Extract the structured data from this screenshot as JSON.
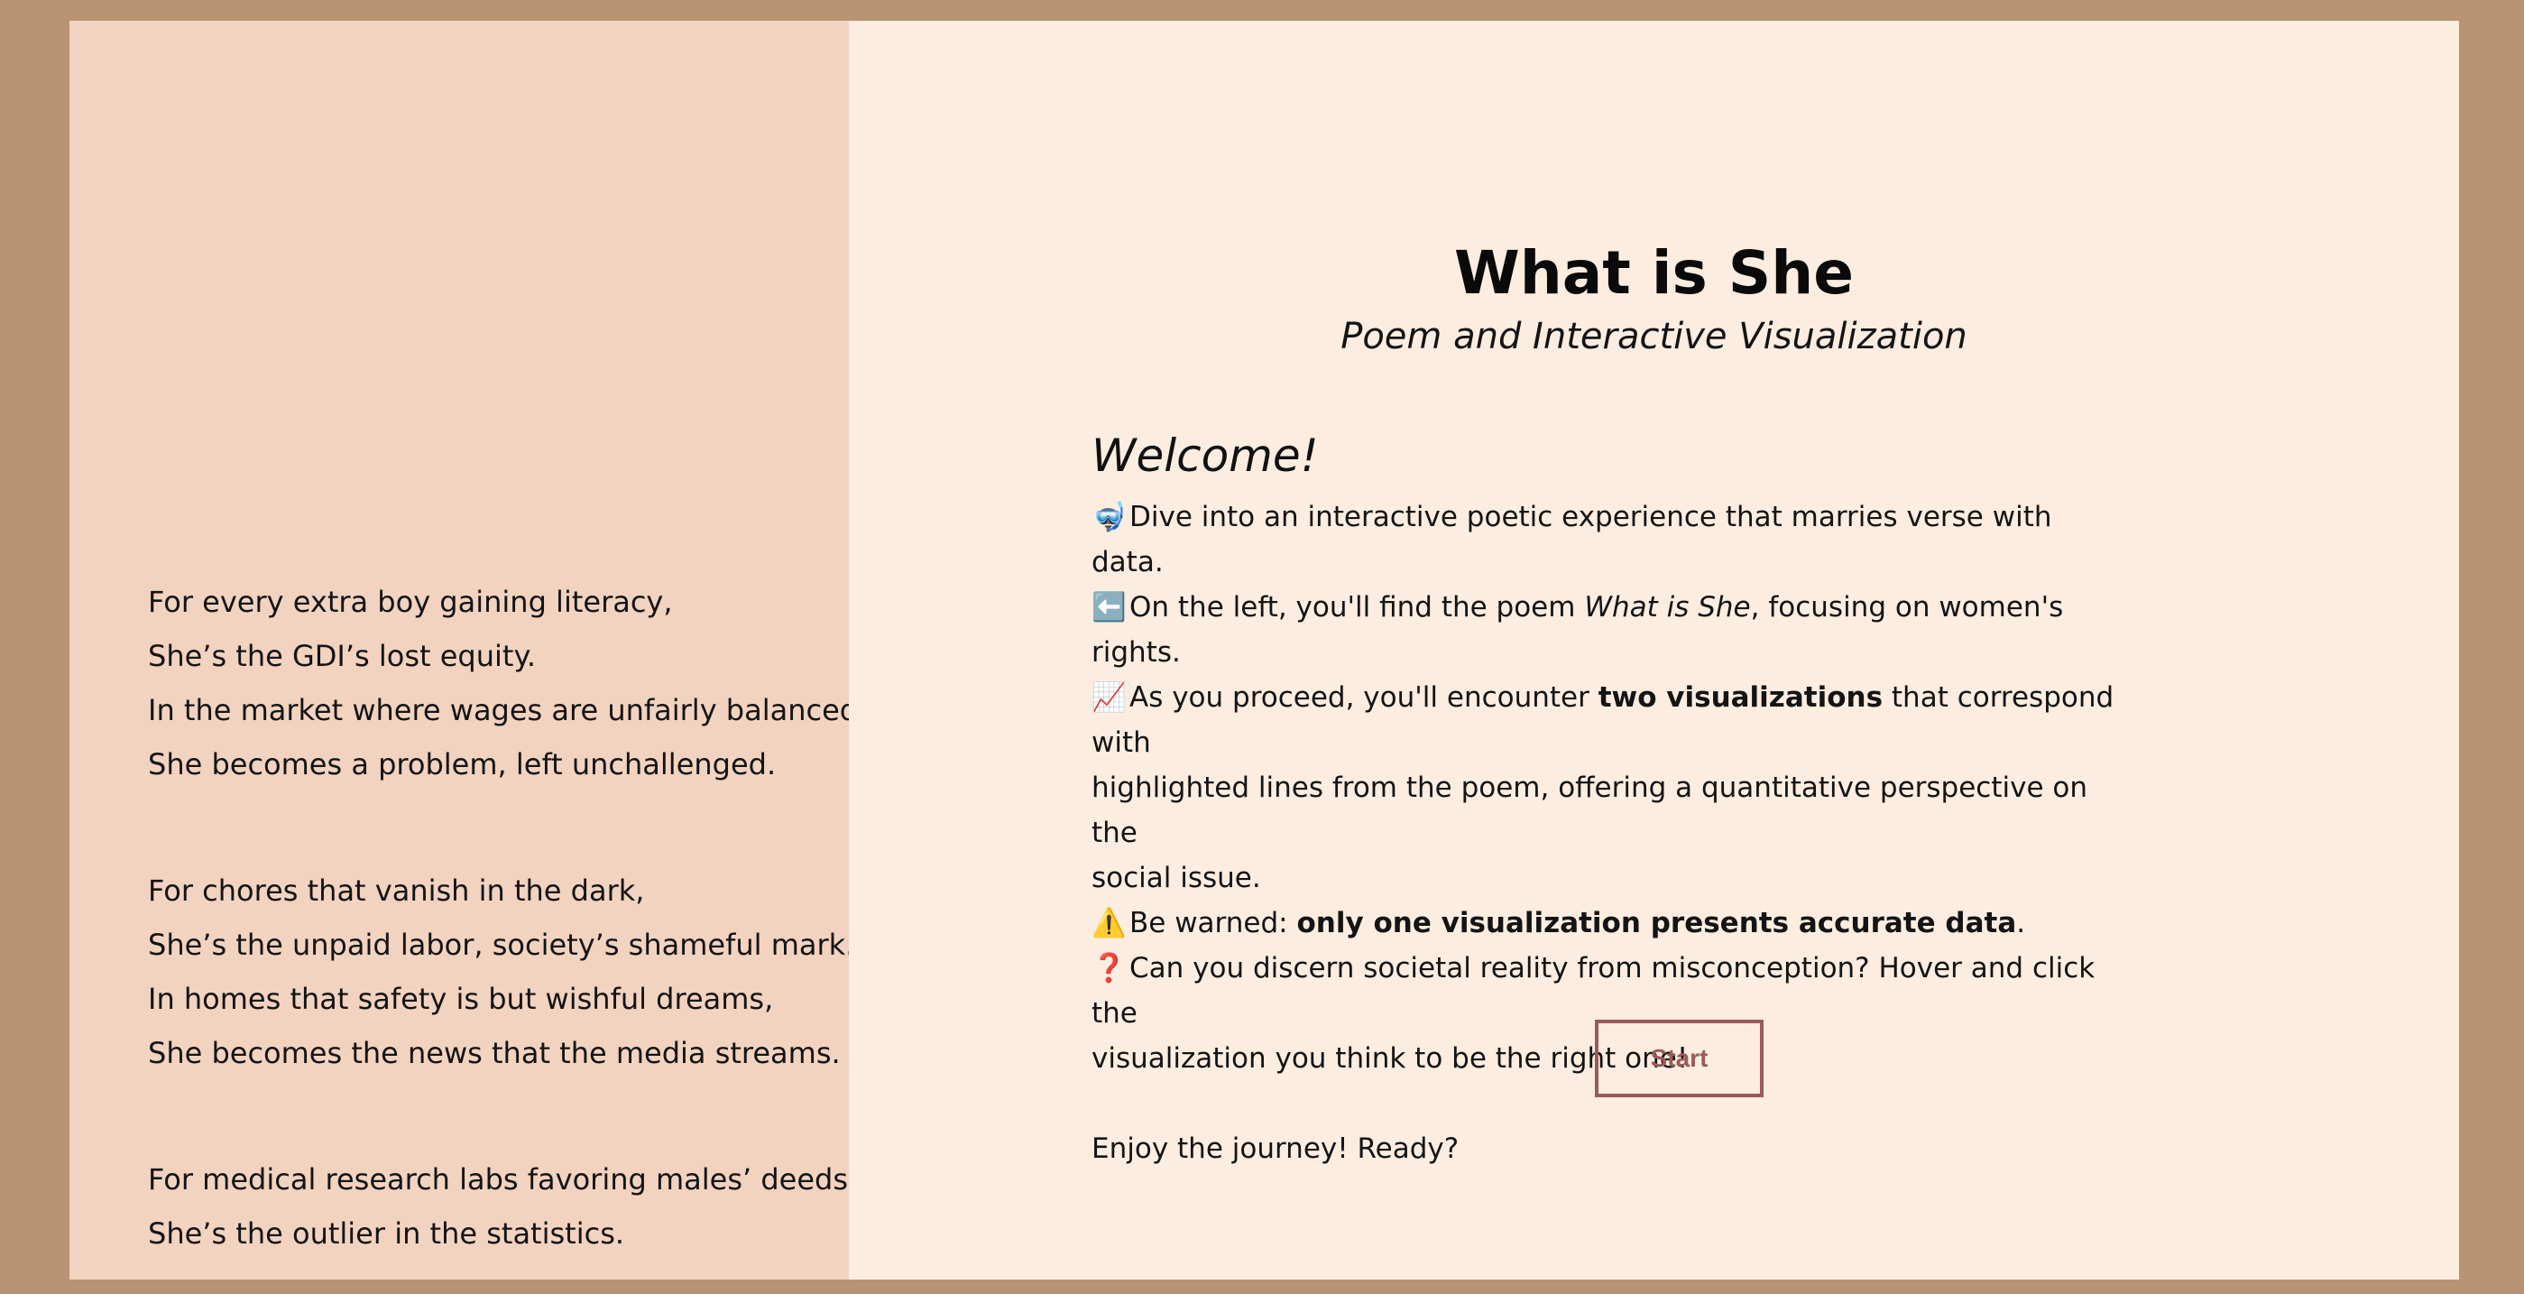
{
  "poem": {
    "stanzas": [
      {
        "lines": [
          "For every extra boy gaining literacy,",
          "She’s the GDI’s lost equity.",
          "In the market where wages are unfairly balanced,",
          "She becomes a problem, left unchallenged."
        ]
      },
      {
        "lines": [
          "For chores that vanish in the dark,",
          "She’s the unpaid labor, society’s shameful mark.",
          "In homes that safety is but wishful dreams,",
          "She becomes the news that the media streams."
        ]
      },
      {
        "lines": [
          "For medical research labs favoring males’ deeds,",
          "She’s the outlier in the statistics."
        ]
      }
    ]
  },
  "header": {
    "title": "What is She",
    "subtitle": "Poem and Interactive Visualization"
  },
  "intro": {
    "heading": "Welcome!",
    "line1": {
      "emoji": "🤿",
      "text": "Dive into an interactive poetic experience that marries verse with data."
    },
    "line2": {
      "emoji": "⬅️",
      "before": "On the left, you'll find the poem ",
      "italic": "What is She",
      "after": ", focusing on women's rights."
    },
    "line3": {
      "emoji": "📈",
      "before": "As you proceed, you'll encounter ",
      "bold": "two visualizations",
      "after_first": " that correspond with",
      "cont1": "highlighted lines from the poem, offering a quantitative perspective on the",
      "cont2": "social issue."
    },
    "line4": {
      "emoji": "⚠️",
      "before": "Be warned: ",
      "bold": "only one visualization presents accurate data",
      "after": "."
    },
    "line5": {
      "emoji": "❓",
      "text": "Can you discern societal reality from misconception? Hover and click the",
      "cont": "visualization you think to be the right one!"
    },
    "closing": "Enjoy the journey! Ready?"
  },
  "start_button": {
    "label": "Start"
  },
  "colors": {
    "outer_background": "#b89474",
    "poem_panel": "#f2d3bf",
    "main_panel": "#fcede0",
    "button_accent": "#9b5a5a"
  }
}
